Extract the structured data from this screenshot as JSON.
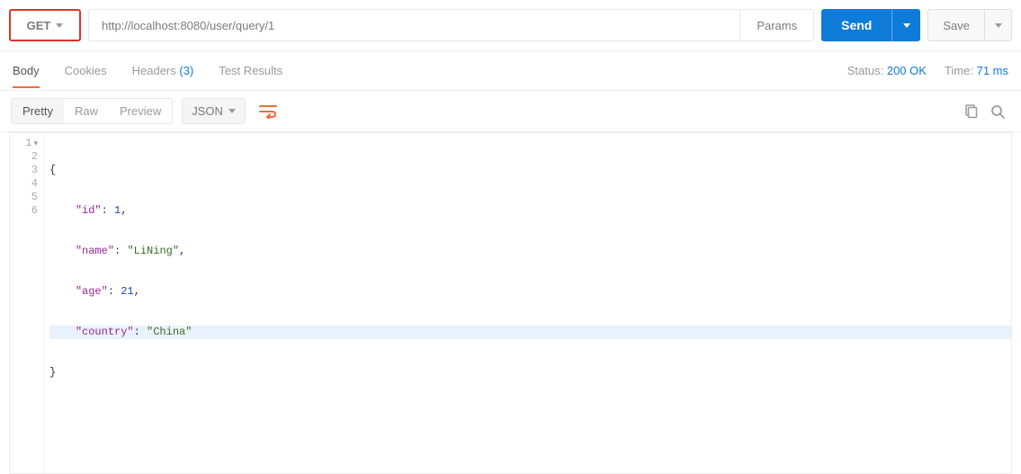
{
  "request": {
    "method": "GET",
    "url": "http://localhost:8080/user/query/1",
    "params_label": "Params",
    "send_label": "Send",
    "save_label": "Save"
  },
  "tabs": {
    "body": "Body",
    "cookies": "Cookies",
    "headers": "Headers",
    "headers_count": "(3)",
    "test_results": "Test Results"
  },
  "status": {
    "status_label": "Status:",
    "status_value": "200 OK",
    "time_label": "Time:",
    "time_value": "71 ms"
  },
  "toolbar": {
    "pretty": "Pretty",
    "raw": "Raw",
    "preview": "Preview",
    "format": "JSON"
  },
  "response_body": {
    "id": 1,
    "name": "LiNing",
    "age": 21,
    "country": "China"
  },
  "code_lines": {
    "l1": "1",
    "l2": "2",
    "l3": "3",
    "l4": "4",
    "l5": "5",
    "l6": "6"
  },
  "code_tokens": {
    "open_brace": "{",
    "close_brace": "}",
    "id_key": "\"id\"",
    "id_val": "1",
    "name_key": "\"name\"",
    "name_val": "\"LiNing\"",
    "age_key": "\"age\"",
    "age_val": "21",
    "country_key": "\"country\"",
    "country_val": "\"China\"",
    "colon_sp": ": ",
    "comma": ","
  }
}
